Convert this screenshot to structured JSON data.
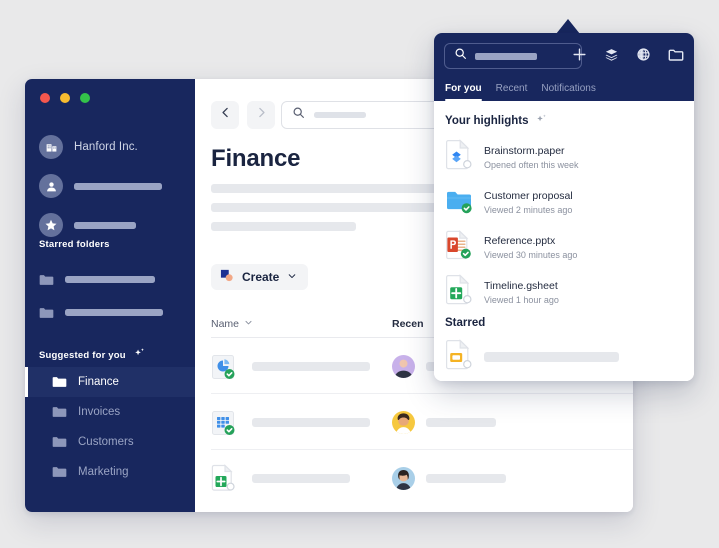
{
  "window": {
    "traffic_lights": [
      "close",
      "minimize",
      "maximize"
    ],
    "colors": {
      "sidebar": "#18275e",
      "sidebar_active": "#203067",
      "accent_white": "#ffffff",
      "page_bg": "#e9e9ea",
      "skeleton": "#e6e8ec"
    }
  },
  "sidebar": {
    "account_name": "Hanford Inc.",
    "account_icon": "building-icon",
    "person_icon": "person-icon",
    "star_icon": "star-icon",
    "starred_folders_title": "Starred folders",
    "suggested_title": "Suggested for you",
    "suggested_icon": "sparkle-icon",
    "suggested_items": [
      {
        "label": "Finance",
        "icon": "folder-icon",
        "active": true
      },
      {
        "label": "Invoices",
        "icon": "folder-icon",
        "active": false
      },
      {
        "label": "Customers",
        "icon": "folder-icon",
        "active": false
      },
      {
        "label": "Marketing",
        "icon": "folder-icon",
        "active": false
      }
    ]
  },
  "main": {
    "back_icon": "chevron-left-icon",
    "forward_icon": "chevron-right-icon",
    "search_icon": "search-icon",
    "search_placeholder": "",
    "page_title": "Finance",
    "create_label": "Create",
    "create_caret": "chevron-down-icon",
    "create_icon": "create-shape-icon",
    "columns": [
      {
        "label": "Name",
        "sort_icon": "chevron-down-icon"
      },
      {
        "label": "Recen",
        "sort_icon": ""
      }
    ],
    "rows": [
      {
        "file_icon": "pie-chart-file-icon",
        "badge": "synced-check-badge",
        "avatar": "avatar-purple"
      },
      {
        "file_icon": "spreadsheet-file-icon",
        "badge": "synced-check-badge",
        "avatar": "avatar-yellow"
      },
      {
        "file_icon": "gsheet-file-icon",
        "badge": "",
        "avatar": "avatar-blue"
      }
    ]
  },
  "popup": {
    "search_icon": "search-icon",
    "search_placeholder": "",
    "header_icons": [
      {
        "name": "plus-icon"
      },
      {
        "name": "layers-icon"
      },
      {
        "name": "globe-icon"
      },
      {
        "name": "folder-icon"
      }
    ],
    "tabs": [
      {
        "label": "For you",
        "active": true
      },
      {
        "label": "Recent",
        "active": false
      },
      {
        "label": "Notifications",
        "active": false
      }
    ],
    "highlights_title": "Your highlights",
    "highlights_icon": "sparkle-icon",
    "highlights": [
      {
        "name": "Brainstorm.paper",
        "meta": "Opened often this week",
        "icon": "paper-file-icon",
        "badge": ""
      },
      {
        "name": "Customer proposal",
        "meta": "Viewed 2 minutes ago",
        "icon": "folder-blue-icon",
        "badge": "synced-check-badge"
      },
      {
        "name": "Reference.pptx",
        "meta": "Viewed 30 minutes ago",
        "icon": "powerpoint-file-icon",
        "badge": "synced-check-badge"
      },
      {
        "name": "Timeline.gsheet",
        "meta": "Viewed 1 hour ago",
        "icon": "gsheet-file-icon",
        "badge": ""
      }
    ],
    "starred_title": "Starred",
    "starred": [
      {
        "icon": "slides-file-icon",
        "name": ""
      }
    ]
  }
}
